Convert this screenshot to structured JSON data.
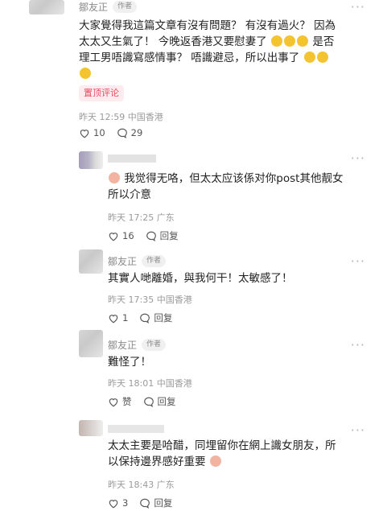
{
  "comments": [
    {
      "username": "鄒友正",
      "badge": "作者",
      "text_lines": [
        "大家覺得我這篇文章有沒有問題？ 有沒有過火？ 因為",
        "太太又生氣了！ 今晚返香港又要慰妻了",
        "理工男唔識寫感情事？ 唔識避忌，所以出事了",
        ""
      ],
      "emoji_tail": [
        "是否"
      ],
      "pin_label": "置顶评论",
      "time": "昨天 12:59",
      "location": "中国香港",
      "likes": "10",
      "replies": "29"
    },
    {
      "username": "",
      "text_lines": [
        "我觉得无咯，但太太应该係对你post其他靓女",
        "所以介意"
      ],
      "time": "昨天 17:25",
      "location": "广东",
      "likes": "16",
      "reply_label": "回复"
    },
    {
      "username": "鄒友正",
      "badge": "作者",
      "text_lines": [
        "其實人哋離婚，與我何干！太敏感了！"
      ],
      "time": "昨天 17:35",
      "location": "中国香港",
      "likes": "1",
      "reply_label": "回复"
    },
    {
      "username": "鄒友正",
      "badge": "作者",
      "text_lines": [
        "難怪了！"
      ],
      "time": "昨天 18:01",
      "location": "中国香港",
      "likes": "赞",
      "reply_label": "回复"
    },
    {
      "username": "",
      "text_lines": [
        "太太主要是哈醋，同埋留你在網上識女朋友，所",
        "以保持邊界感好重要"
      ],
      "time": "昨天 18:43",
      "location": "广东",
      "likes": "3",
      "reply_label": "回复"
    }
  ],
  "icons": {
    "like": "heart-outline-icon",
    "reply": "speech-bubble-icon",
    "more": "more-dots-icon",
    "emoji_face": "emoji-face-icon"
  },
  "colors": {
    "pin_text": "#e84a5f",
    "pin_bg": "#fdecef",
    "meta": "#9a9a9a"
  }
}
